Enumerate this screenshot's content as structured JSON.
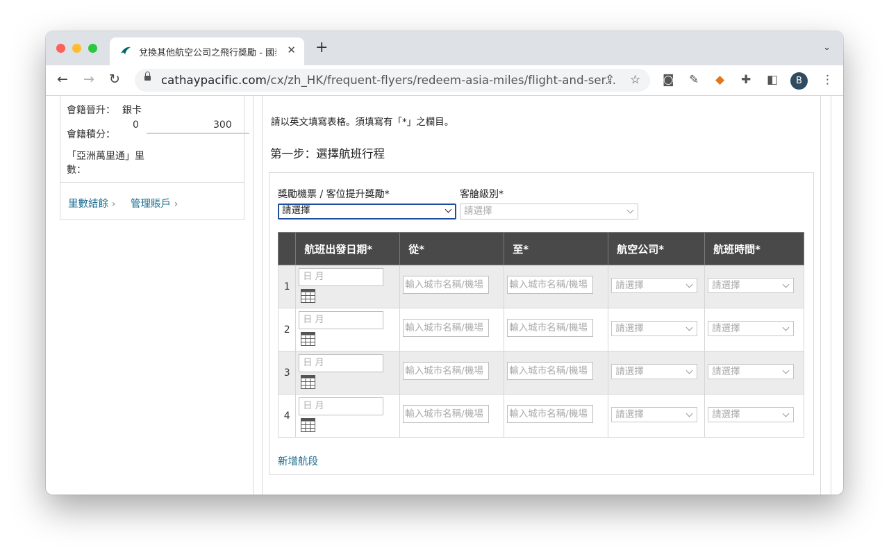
{
  "browser": {
    "tab_title": "兌換其他航空公司之飛行獎勵 - 國泰航空",
    "url_host": "cathaypacific.com",
    "url_path": "/cx/zh_HK/frequent-flyers/redeem-asia-miles/flight-and-ser...",
    "profile_initial": "B"
  },
  "sidebar": {
    "tier_label": "會籍晉升：",
    "tier_value": "銀卡",
    "points_label": "會籍積分：",
    "points_min": "0",
    "points_max": "300",
    "points_progress": 0,
    "miles_label_line1": "「亞洲萬里通」里",
    "miles_label_line2": "數：",
    "link_balance": "里數結餘",
    "link_account": "管理賬戶"
  },
  "main": {
    "instruction": "請以英文填寫表格。須填寫有「*」之欄目。",
    "step_title": "第一步：選擇航班行程",
    "award_type_label": "獎勵機票 / 客位提升獎勵*",
    "award_type_value": "請選擇",
    "cabin_label": "客艙級別*",
    "cabin_value": "請選擇",
    "table": {
      "headers": [
        "航班出發日期*",
        "從*",
        "至*",
        "航空公司*",
        "航班時間*"
      ],
      "rows": [
        {
          "num": "1",
          "date_placeholder": "日 月",
          "from_placeholder": "輸入城市名稱/機場",
          "to_placeholder": "輸入城市名稱/機場",
          "airline": "請選擇",
          "time": "請選擇"
        },
        {
          "num": "2",
          "date_placeholder": "日 月",
          "from_placeholder": "輸入城市名稱/機場",
          "to_placeholder": "輸入城市名稱/機場",
          "airline": "請選擇",
          "time": "請選擇"
        },
        {
          "num": "3",
          "date_placeholder": "日 月",
          "from_placeholder": "輸入城市名稱/機場",
          "to_placeholder": "輸入城市名稱/機場",
          "airline": "請選擇",
          "time": "請選擇"
        },
        {
          "num": "4",
          "date_placeholder": "日 月",
          "from_placeholder": "輸入城市名稱/機場",
          "to_placeholder": "輸入城市名稱/機場",
          "airline": "請選擇",
          "time": "請選擇"
        }
      ]
    },
    "add_segment": "新增航段"
  }
}
